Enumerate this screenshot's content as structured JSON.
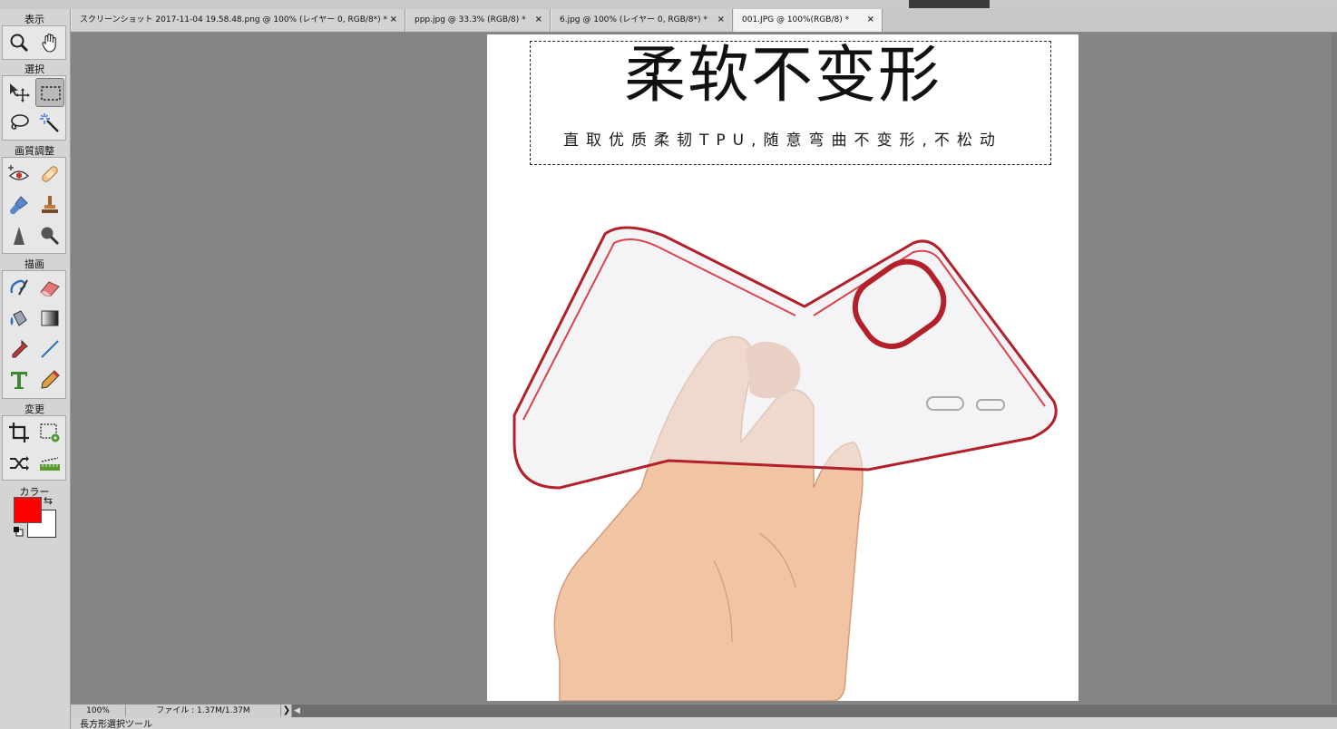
{
  "tabs": [
    {
      "label": "スクリーンショット 2017-11-04 19.58.48.png @ 100% (レイヤー 0, RGB/8*) *",
      "close": "×",
      "active": false
    },
    {
      "label": "ppp.jpg @ 33.3% (RGB/8) *",
      "close": "×",
      "active": false
    },
    {
      "label": "6.jpg @ 100% (レイヤー 0, RGB/8*) *",
      "close": "×",
      "active": false
    },
    {
      "label": "001.JPG @ 100%(RGB/8) *",
      "close": "×",
      "active": true
    }
  ],
  "toolbox": {
    "sections": {
      "view": "表示",
      "select": "選択",
      "enhance": "画質調整",
      "draw": "描画",
      "modify": "変更",
      "color": "カラー"
    },
    "tools": {
      "zoom": "zoom-icon",
      "hand": "hand-icon",
      "move": "move-icon",
      "rect_marquee": "rectangular-marquee-icon",
      "lasso": "lasso-icon",
      "magic_wand": "magic-wand-icon",
      "red_eye": "red-eye-icon",
      "healing": "healing-brush-icon",
      "brush_enhance": "smart-brush-icon",
      "stamp": "clone-stamp-icon",
      "sharpen": "blur-icon",
      "sponge": "sponge-icon",
      "paint_brush": "brush-icon",
      "eraser": "eraser-icon",
      "bucket": "paint-bucket-icon",
      "gradient": "gradient-icon",
      "eyedropper": "eyedropper-icon",
      "line": "line-icon",
      "text": "type-icon",
      "pencil": "pencil-icon",
      "crop": "crop-icon",
      "recompose": "recompose-icon",
      "content_move": "content-aware-move-icon",
      "straighten": "straighten-icon"
    },
    "foreground_color": "#ff0000",
    "background_color": "#ffffff"
  },
  "canvas": {
    "headline": "柔软不变形",
    "subline": "直取优质柔韧TPU,随意弯曲不变形,不松动"
  },
  "status": {
    "zoom": "100%",
    "file": "ファイル : 1.37M/1.37M",
    "arrow": "❯",
    "scroll_left": "◀",
    "hint": "長方形選択ツール"
  }
}
